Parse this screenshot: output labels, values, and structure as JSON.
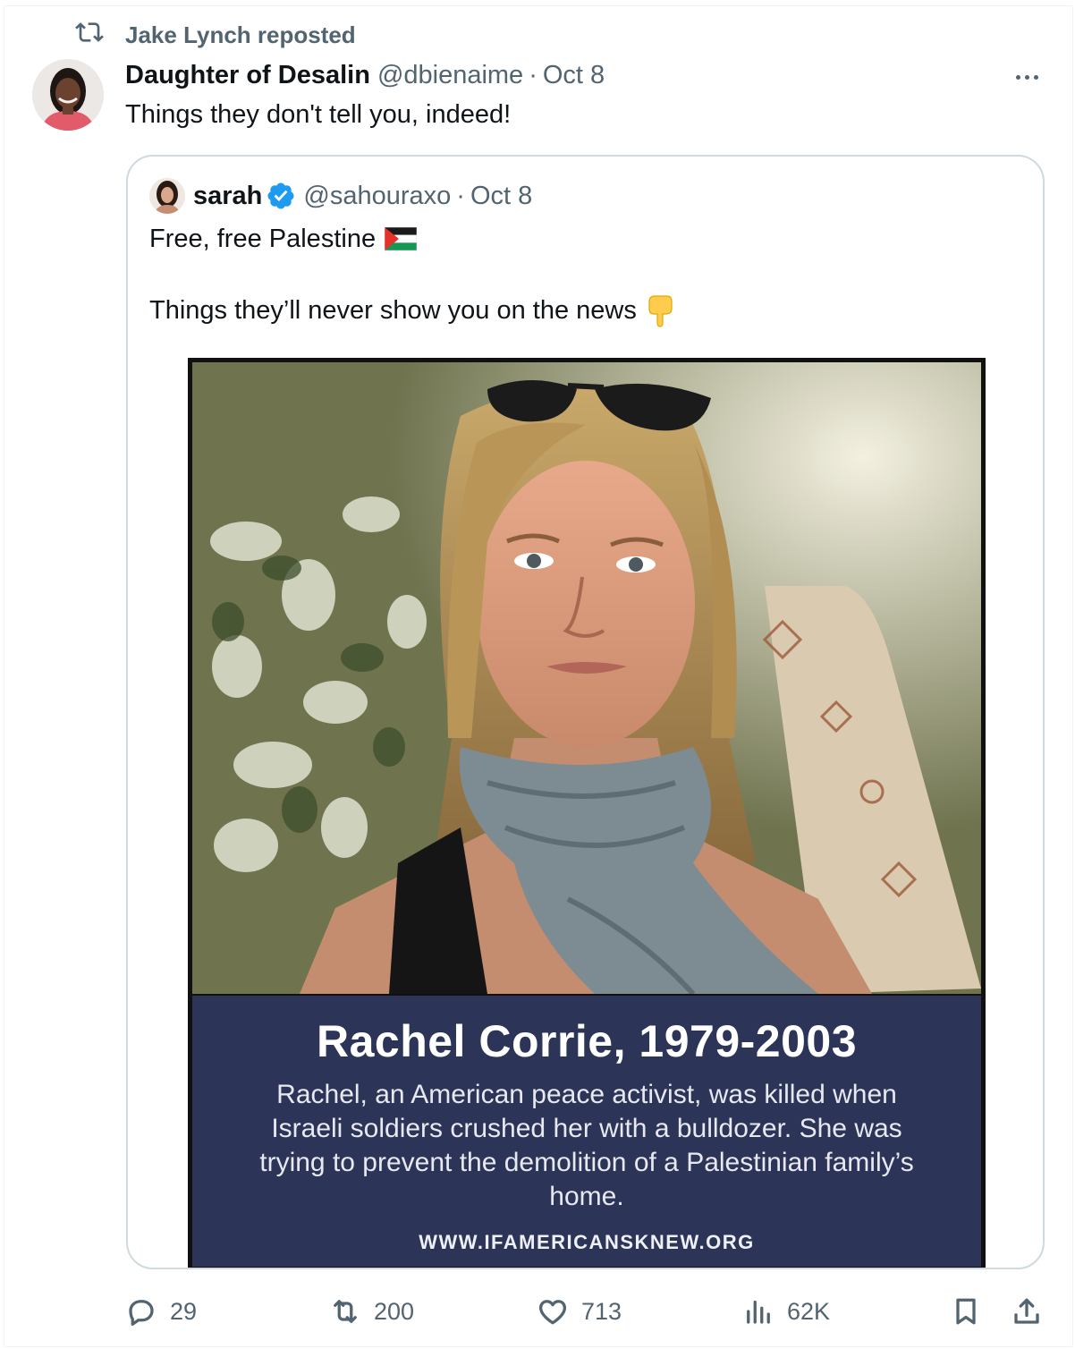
{
  "repost": {
    "text": "Jake Lynch reposted"
  },
  "post": {
    "author_name": "Daughter of Desalin",
    "handle": "@dbienaime",
    "separator": "·",
    "date": "Oct 8",
    "text": "Things they don't tell you, indeed!"
  },
  "quote": {
    "author_name": "sarah",
    "handle": "@sahouraxo",
    "separator": "·",
    "date": "Oct 8",
    "line1": "Free, free Palestine",
    "line2": "Things they’ll never show you on the news",
    "media": {
      "title": "Rachel Corrie, 1979-2003",
      "body": "Rachel, an American peace activist, was killed when Israeli soldiers crushed her with a bulldozer. She was trying to prevent the demolition of a Palestinian family’s home.",
      "url": "WWW.IFAMERICANSKNEW.ORG"
    }
  },
  "actions": {
    "replies": "29",
    "reposts": "200",
    "likes": "713",
    "views": "62K"
  },
  "icons": {
    "repost": "repost-icon",
    "reply": "reply-icon",
    "like": "heart-icon",
    "views": "views-chart-icon",
    "bookmark": "bookmark-icon",
    "share": "share-icon",
    "verified": "verified-badge-icon",
    "more": "more-dots-icon"
  },
  "colors": {
    "text": "#0f1419",
    "secondary": "#536471",
    "border": "#cfd9de",
    "verified": "#1d9bf0",
    "caption_bg": "#2c3457"
  }
}
